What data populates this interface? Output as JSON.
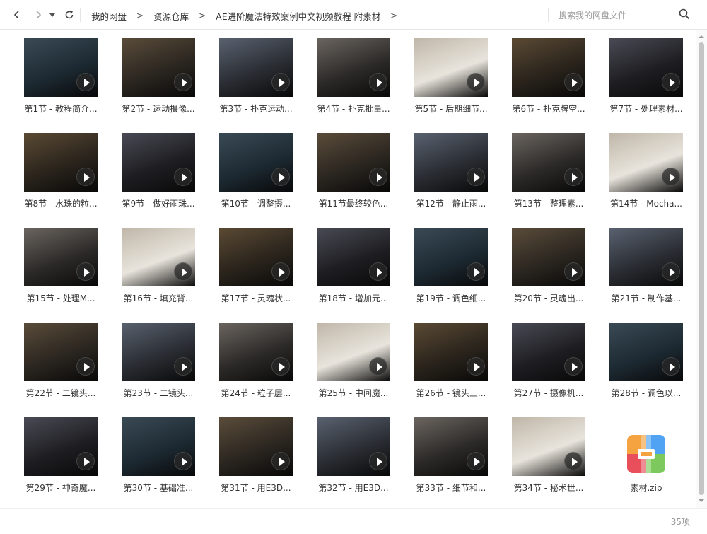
{
  "breadcrumb": {
    "items": [
      "我的网盘",
      "资源仓库",
      "AE进阶魔法特效案例中文视频教程 附素材"
    ],
    "separator": ">"
  },
  "search": {
    "placeholder": "搜索我的网盘文件"
  },
  "icons": {
    "back": "chevron-left-icon",
    "forward": "chevron-right-icon",
    "history": "caret-down-icon",
    "refresh": "refresh-icon",
    "search": "search-icon",
    "play": "play-icon",
    "zip": "zip-archive-icon"
  },
  "files": [
    "第1节 - 教程简介...",
    "第2节 - 运动摄像...",
    "第3节 - 扑克运动...",
    "第4节 - 扑克批量...",
    "第5节 - 后期细节...",
    "第6节 - 扑克牌空...",
    "第7节 - 处理素材...",
    "第8节 - 水珠的粒...",
    "第9节 - 做好雨珠...",
    "第10节 - 调整摄...",
    "第11节最终较色...",
    "第12节 - 静止雨...",
    "第13节 - 整理素...",
    "第14节 - Mocha...",
    "第15节 - 处理M...",
    "第16节 - 填充背...",
    "第17节 - 灵魂状...",
    "第18节 - 增加元...",
    "第19节 - 调色细...",
    "第20节 - 灵魂出...",
    "第21节 - 制作基...",
    "第22节 - 二镜头...",
    "第23节 - 二镜头...",
    "第24节 - 粒子层...",
    "第25节 - 中间魔...",
    "第26节 - 镜头三...",
    "第27节 - 摄像机...",
    "第28节 - 调色以...",
    "第29节 - 神奇魔...",
    "第30节 - 基础准...",
    "第31节 - 用E3D...",
    "第32节 - 用E3D...",
    "第33节 - 细节和...",
    "第34节 - 秘术世...",
    "素材.zip"
  ],
  "status": {
    "count": "35项"
  },
  "colors": {
    "accent": "#3b8cff",
    "thumb_bg": "#0b0b0b",
    "zip_colors": [
      "#f4a340",
      "#4fa3f2",
      "#e94e5b",
      "#7dc95e"
    ]
  }
}
